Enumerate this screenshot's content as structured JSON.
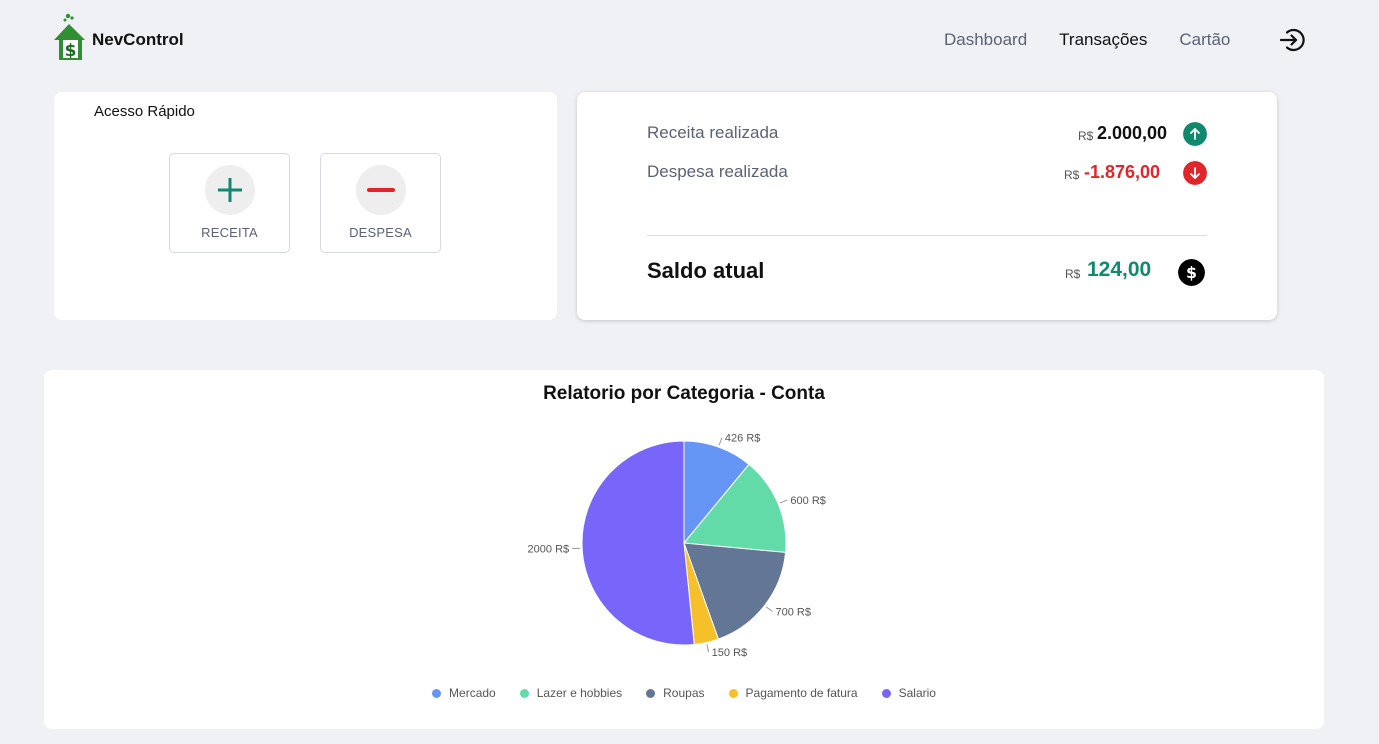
{
  "app": {
    "name": "NevControl"
  },
  "nav": {
    "items": [
      {
        "label": "Dashboard",
        "active": false
      },
      {
        "label": "Transações",
        "active": true
      },
      {
        "label": "Cartão",
        "active": false
      }
    ],
    "logout_icon": "logout-icon"
  },
  "quick_access": {
    "title": "Acesso Rápido",
    "receita_label": "RECEITA",
    "despesa_label": "DESPESA"
  },
  "summary": {
    "currency": "R$",
    "receita": {
      "label": "Receita realizada",
      "value": "2.000,00",
      "color": "#111111",
      "icon_color": "#108a6e"
    },
    "despesa": {
      "label": "Despesa realizada",
      "value": "-1.876,00",
      "color": "#e0262b",
      "icon_color": "#e0262b"
    },
    "saldo": {
      "label": "Saldo atual",
      "value": "124,00",
      "color": "#108a6e",
      "icon_color": "#000000"
    }
  },
  "chart_data": {
    "type": "pie",
    "title": "Relatorio por Categoria - Conta",
    "unit": "R$",
    "series": [
      {
        "name": "Mercado",
        "value": 426,
        "color": "#6596f5"
      },
      {
        "name": "Lazer e hobbies",
        "value": 600,
        "color": "#62dba9"
      },
      {
        "name": "Roupas",
        "value": 700,
        "color": "#647696"
      },
      {
        "name": "Pagamento de fatura",
        "value": 150,
        "color": "#f6c02b"
      },
      {
        "name": "Salario",
        "value": 2000,
        "color": "#7766f9"
      }
    ]
  }
}
